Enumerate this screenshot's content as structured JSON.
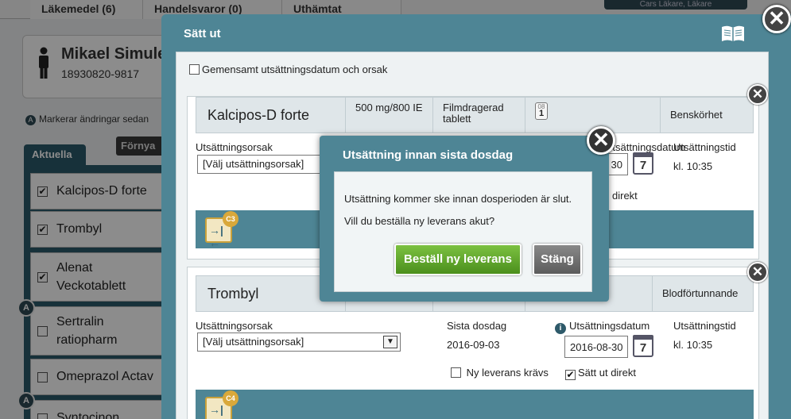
{
  "background": {
    "tabs": [
      "Läkemedel (6)",
      "Handelsvaror (0)",
      "Uthämtat"
    ],
    "top_button": "Cars Läkare, Läkare",
    "patient": {
      "name": "Mikael Simule",
      "personnummer": "18930820-9817"
    },
    "notice": "Markerar ändringar sedan",
    "aktuella_tab": "Aktuella",
    "fornya_button": "Förnya",
    "med_list": [
      {
        "label": "Kalcipos-D forte",
        "checked": "✔"
      },
      {
        "label": "Trombyl",
        "checked": "✔"
      },
      {
        "label": "Alenat Veckotablett",
        "checked": "✔"
      },
      {
        "label": "Sertralin ratiopharm",
        "checked": ""
      },
      {
        "label": "Omeprazol Actav",
        "checked": ""
      },
      {
        "label": "Syntocinon",
        "checked": ""
      }
    ],
    "a_badge": "A"
  },
  "dialog": {
    "title": "Sätt ut",
    "common_checkbox_label": "Gemensamt utsättningsdatum och orsak",
    "close_glyph": "✕",
    "items": [
      {
        "name": "Kalcipos-D forte",
        "strength": "500 mg/800 IE",
        "form": "Filmdragerad tablett",
        "dose_badge_top": "08",
        "dose_badge_value": "1",
        "indication": "Benskörhet",
        "reason_label": "Utsättningsorsak",
        "reason_value": "[Välj utsättningsorsak]",
        "stop_date_label": "Utsättningsdatum",
        "stop_date_partial": "30",
        "stop_time_label": "Utsättningstid",
        "stop_time_value": "kl. 10:35",
        "stop_direct_partial": "direkt",
        "cal_num": "7",
        "badge": "C3"
      },
      {
        "name": "Trombyl",
        "indication": "Blodförtunnande",
        "reason_label": "Utsättningsorsak",
        "reason_value": "[Välj utsättningsorsak]",
        "last_dose_label": "Sista dosdag",
        "last_dose_value": "2016-09-03",
        "stop_date_label": "Utsättningsdatum",
        "stop_date_value": "2016-08-30",
        "stop_time_label": "Utsättningstid",
        "stop_time_value": "kl. 10:35",
        "new_delivery_label": "Ny leverans krävs",
        "stop_direct_label": "Sätt ut direkt",
        "stop_direct_check": "✔",
        "cal_num": "7",
        "badge": "C4"
      }
    ]
  },
  "popup": {
    "title": "Utsättning innan sista dosdag",
    "message1": "Utsättning kommer ske innan dosperioden är slut.",
    "message2": "Vill du beställa ny leverans akut?",
    "order_button": "Beställ ny leverans",
    "close_button": "Stäng",
    "close_glyph": "✕"
  },
  "colors": {
    "accent": "#4e8595",
    "order_button": "#5fa62c",
    "close_button": "#6e6e6e"
  }
}
